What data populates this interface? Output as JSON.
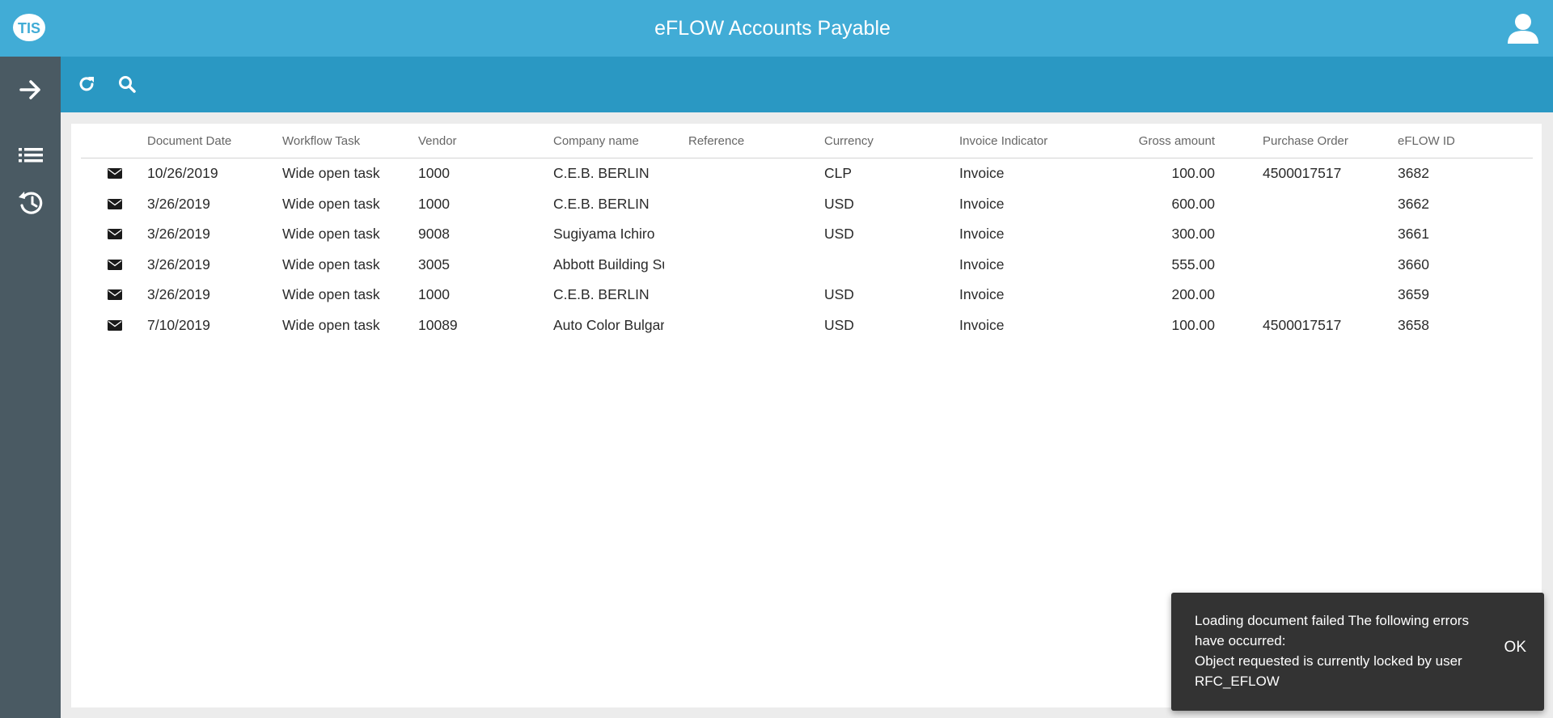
{
  "header": {
    "app_title": "eFLOW Accounts Payable",
    "logo_text": "TIS",
    "accent_color": "#41acd6",
    "toolbar_color": "#2a98c3",
    "sidebar_color": "#4a5a63"
  },
  "sidebar": {
    "items": [
      {
        "icon": "arrow-right-icon"
      },
      {
        "icon": "list-icon"
      },
      {
        "icon": "history-icon"
      }
    ]
  },
  "toolbar": {
    "items": [
      {
        "icon": "refresh-icon"
      },
      {
        "icon": "search-icon"
      }
    ]
  },
  "table": {
    "columns": [
      "Document Date",
      "Workflow Task",
      "Vendor",
      "Company name",
      "Reference",
      "Currency",
      "Invoice Indicator",
      "Gross amount",
      "Purchase Order",
      "eFLOW ID"
    ],
    "rows": [
      {
        "date": "10/26/2019",
        "task": "Wide open task",
        "vendor": "1000",
        "company": "C.E.B. BERLIN",
        "reference": "",
        "currency": "CLP",
        "indicator": "Invoice",
        "gross": "100.00",
        "po": "4500017517",
        "id": "3682"
      },
      {
        "date": "3/26/2019",
        "task": "Wide open task",
        "vendor": "1000",
        "company": "C.E.B. BERLIN",
        "reference": "",
        "currency": "USD",
        "indicator": "Invoice",
        "gross": "600.00",
        "po": "",
        "id": "3662"
      },
      {
        "date": "3/26/2019",
        "task": "Wide open task",
        "vendor": "9008",
        "company": "Sugiyama Ichiro",
        "reference": "",
        "currency": "USD",
        "indicator": "Invoice",
        "gross": "300.00",
        "po": "",
        "id": "3661"
      },
      {
        "date": "3/26/2019",
        "task": "Wide open task",
        "vendor": "3005",
        "company": "Abbott Building Su",
        "reference": "",
        "currency": "",
        "indicator": "Invoice",
        "gross": "555.00",
        "po": "",
        "id": "3660"
      },
      {
        "date": "3/26/2019",
        "task": "Wide open task",
        "vendor": "1000",
        "company": "C.E.B. BERLIN",
        "reference": "",
        "currency": "USD",
        "indicator": "Invoice",
        "gross": "200.00",
        "po": "",
        "id": "3659"
      },
      {
        "date": "7/10/2019",
        "task": "Wide open task",
        "vendor": "10089",
        "company": "Auto Color Bulgar",
        "reference": "",
        "currency": "USD",
        "indicator": "Invoice",
        "gross": "100.00",
        "po": "4500017517",
        "id": "3658"
      }
    ]
  },
  "toast": {
    "lines": [
      "Loading document failed The following errors",
      "have occurred:",
      "Object requested is currently locked by user",
      "RFC_EFLOW"
    ],
    "ok_label": "OK"
  }
}
